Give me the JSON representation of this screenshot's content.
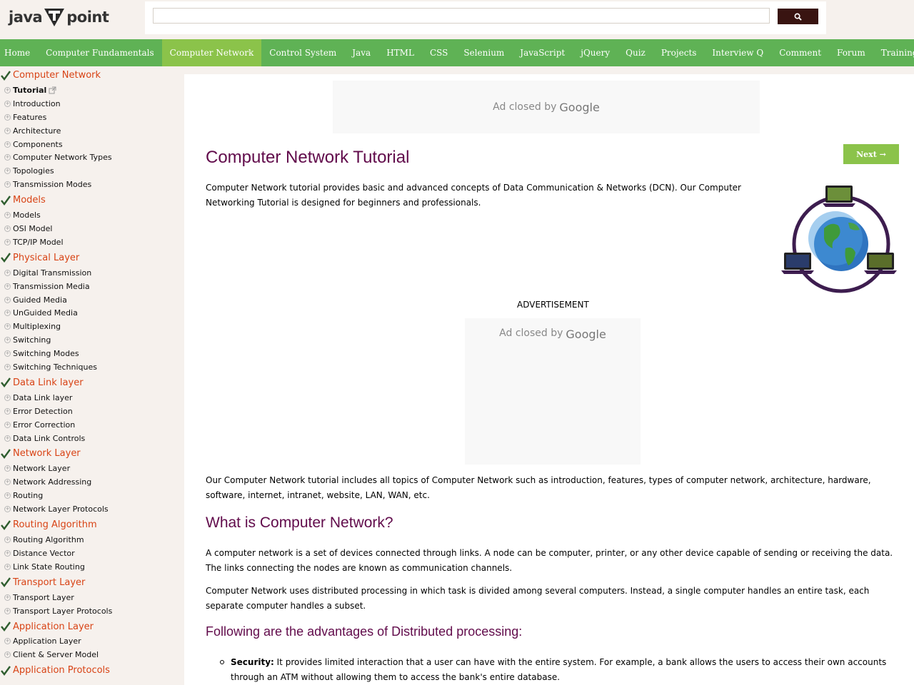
{
  "header": {
    "logo_left": "java",
    "logo_right": "point",
    "search": {
      "value": "",
      "placeholder": ""
    }
  },
  "nav": {
    "items": [
      {
        "label": "Home",
        "active": false
      },
      {
        "label": "Computer Fundamentals",
        "active": false
      },
      {
        "label": "Computer Network",
        "active": true
      },
      {
        "label": "Control System",
        "active": false
      },
      {
        "label": "Java",
        "active": false
      },
      {
        "label": "HTML",
        "active": false
      },
      {
        "label": "CSS",
        "active": false
      },
      {
        "label": "Selenium",
        "active": false
      },
      {
        "label": "JavaScript",
        "active": false
      },
      {
        "label": "jQuery",
        "active": false
      },
      {
        "label": "Quiz",
        "active": false
      },
      {
        "label": "Projects",
        "active": false
      },
      {
        "label": "Interview Q",
        "active": false
      },
      {
        "label": "Comment",
        "active": false
      },
      {
        "label": "Forum",
        "active": false
      },
      {
        "label": "Training",
        "active": false
      }
    ]
  },
  "sidebar": {
    "sections": [
      {
        "title": "Computer Network",
        "items": [
          "Tutorial",
          "Introduction",
          "Features",
          "Architecture",
          "Components",
          "Computer Network Types",
          "Topologies",
          "Transmission Modes"
        ]
      },
      {
        "title": "Models",
        "items": [
          "Models",
          "OSI Model",
          "TCP/IP Model"
        ]
      },
      {
        "title": "Physical Layer",
        "items": [
          "Digital Transmission",
          "Transmission Media",
          "Guided Media",
          "UnGuided Media",
          "Multiplexing",
          "Switching",
          "Switching Modes",
          "Switching Techniques"
        ]
      },
      {
        "title": "Data Link layer",
        "items": [
          "Data Link layer",
          "Error Detection",
          "Error Correction",
          "Data Link Controls"
        ]
      },
      {
        "title": "Network Layer",
        "items": [
          "Network Layer",
          "Network Addressing",
          "Routing",
          "Network Layer Protocols"
        ]
      },
      {
        "title": "Routing Algorithm",
        "items": [
          "Routing Algorithm",
          "Distance Vector",
          "Link State Routing"
        ]
      },
      {
        "title": "Transport Layer",
        "items": [
          "Transport Layer",
          "Transport Layer Protocols"
        ]
      },
      {
        "title": "Application Layer",
        "items": [
          "Application Layer",
          "Client & Server Model"
        ]
      },
      {
        "title": "Application Protocols",
        "items": []
      }
    ]
  },
  "main": {
    "ad_closed_text": "Ad closed by",
    "ad_brand": "Google",
    "advertisement_label": "ADVERTISEMENT",
    "title": "Computer Network Tutorial",
    "next_label": "Next →",
    "intro": "Computer Network tutorial provides basic and advanced concepts of Data Communication & Networks (DCN). Our Computer Networking Tutorial is designed for beginners and professionals.",
    "topics": "Our Computer Network tutorial includes all topics of Computer Network such as introduction, features, types of computer network, architecture, hardware, software, internet, intranet, website, LAN, WAN, etc.",
    "what_heading": "What is Computer Network?",
    "what_p1": "A computer network is a set of devices connected through links. A node can be computer, printer, or any other device capable of sending or receiving the data. The links connecting the nodes are known as communication channels.",
    "what_p2": "Computer Network uses distributed processing in which task is divided among several computers. Instead, a single computer handles an entire task, each separate computer handles a subset.",
    "adv_heading": "Following are the advantages of Distributed processing:",
    "bullet_term": "Security:",
    "bullet_text": " It provides limited interaction that a user can have with the entire system. For example, a bank allows the users to access their own accounts through an ATM without allowing them to access the bank's entire database."
  },
  "colors": {
    "nav_bg": "#5fb255",
    "nav_active": "#8bc34a",
    "heading": "#610b4b",
    "section_title": "#d84315",
    "search_button": "#391411"
  }
}
